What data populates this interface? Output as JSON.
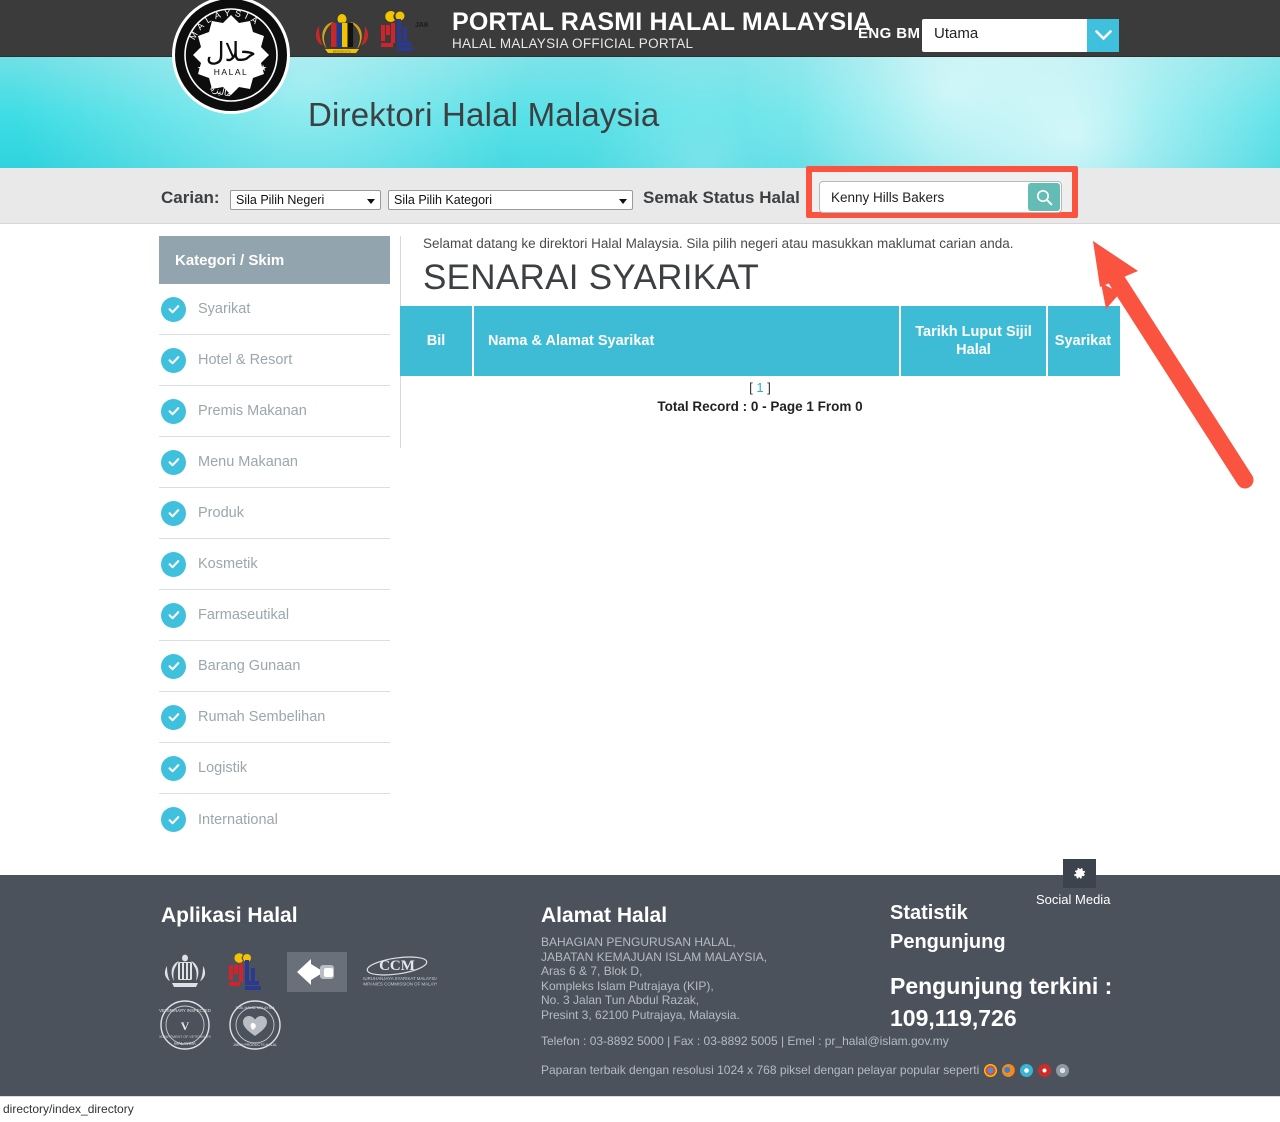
{
  "topbar": {
    "title": "PORTAL RASMI HALAL MALAYSIA",
    "subtitle": "HALAL MALAYSIA OFFICIAL PORTAL",
    "lang_eng": "ENG",
    "lang_bm": "BM",
    "nav_select_value": "Utama",
    "halal_logo_alt": "halal-malaysia-logo",
    "crest_alt": "malaysia-coat-of-arms",
    "jakim_alt": "jakim-logo"
  },
  "banner": {
    "title": "Direktori Halal Malaysia"
  },
  "search": {
    "carian_label": "Carian:",
    "negeri_value": "Sila Pilih Negeri",
    "kategori_value": "Sila Pilih Kategori",
    "semak_label": "Semak Status Halal :",
    "query_value": "Kenny Hills Bakers",
    "query_placeholder": "",
    "search_icon": "search-icon",
    "highlight_color": "#fa5440",
    "button_color": "#63bdb5"
  },
  "sidebar": {
    "header": "Kategori / Skim",
    "items": [
      {
        "label": "Syarikat"
      },
      {
        "label": "Hotel & Resort"
      },
      {
        "label": "Premis Makanan"
      },
      {
        "label": "Menu Makanan"
      },
      {
        "label": "Produk"
      },
      {
        "label": "Kosmetik"
      },
      {
        "label": "Farmaseutikal"
      },
      {
        "label": "Barang Gunaan"
      },
      {
        "label": "Rumah Sembelihan"
      },
      {
        "label": "Logistik"
      },
      {
        "label": "International"
      }
    ]
  },
  "main": {
    "welcome": "Selamat datang ke direktori Halal Malaysia. Sila pilih negeri atau masukkan maklumat carian anda.",
    "heading": "SENARAI SYARIKAT",
    "table_headers": {
      "bil": "Bil",
      "nama": "Nama & Alamat Syarikat",
      "tarikh": "Tarikh Luput Sijil Halal",
      "syarikat": "Syarikat"
    },
    "rows": [],
    "page_open": "[",
    "page_number": "1",
    "page_close": "]",
    "total_record": "Total Record : 0 - Page 1 From 0",
    "header_color": "#3fbcd5"
  },
  "footer": {
    "apps_heading": "Aplikasi Halal",
    "address_heading": "Alamat Halal",
    "address_lines": [
      "BAHAGIAN PENGURUSAN HALAL,",
      "JABATAN KEMAJUAN ISLAM MALAYSIA,",
      "Aras 6 & 7, Blok D,",
      "Kompleks Islam Putrajaya (KIP),",
      "No. 3 Jalan Tun Abdul Razak,",
      "Presint 3, 62100 Putrajaya, Malaysia."
    ],
    "contact": "Telefon : 03-8892 5000 | Fax : 03-8892 5005 | Emel : pr_halal@islam.gov.my",
    "browsers_text": "Paparan terbaik dengan resolusi 1024 x 768 piksel dengan pelayar popular seperti",
    "stats_heading_line1": "Statistik",
    "stats_heading_line2": "Pengunjung",
    "visitors_label": "Pengunjung terkini :",
    "visitors_count": "109,119,726",
    "social_media_label": "Social Media",
    "social_icon": "gear-icon",
    "logo_alts": [
      "malaysia-coat-of-arms-logo",
      "jakim-logo",
      "myipo-logo",
      "ssm-logo",
      "veterinary-services-logo",
      "halal-heart-logo"
    ]
  },
  "statusbar": {
    "url": "directory/index_directory"
  },
  "annotation": {
    "arrow_color": "#fa5440",
    "arrow_name": "pointer-arrow"
  }
}
